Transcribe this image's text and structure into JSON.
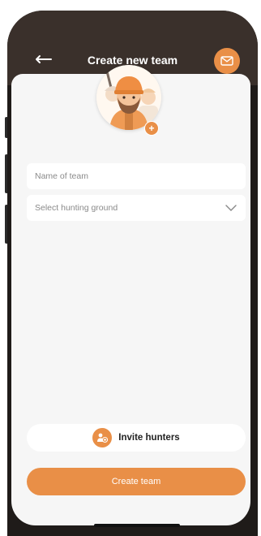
{
  "header": {
    "title": "Create new team",
    "back_icon": "arrow-left-icon",
    "mail_icon": "envelope-icon"
  },
  "form": {
    "team_name": {
      "value": "",
      "placeholder": "Name of team"
    },
    "hunting_ground": {
      "selected": "Select hunting ground",
      "icon": "chevron-down-icon"
    }
  },
  "actions": {
    "invite_label": "Invite hunters",
    "create_label": "Create team"
  },
  "colors": {
    "accent": "#e98f47",
    "header_bg": "#3a302b",
    "sheet_bg": "#f6f6f6"
  }
}
